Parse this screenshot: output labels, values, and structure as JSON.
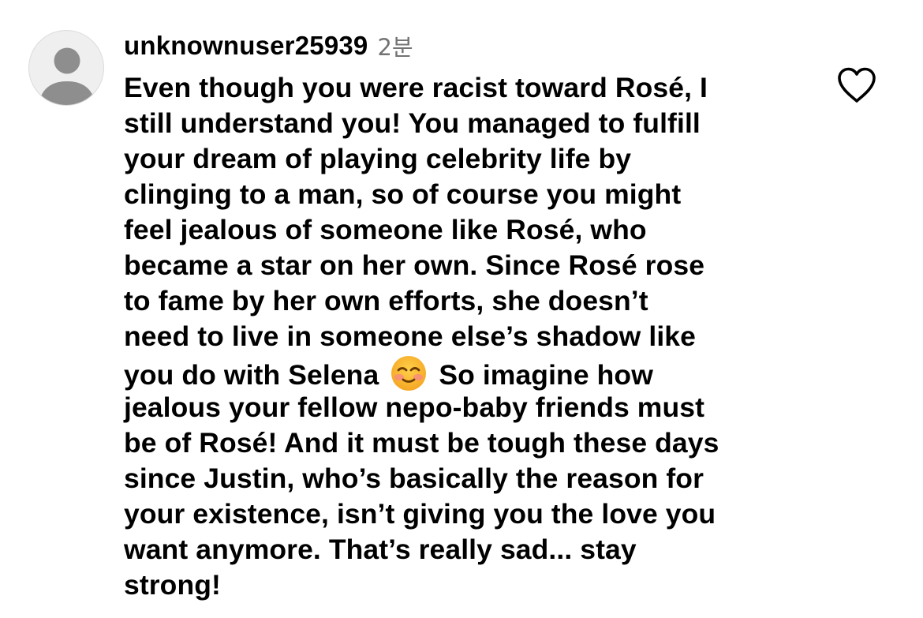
{
  "comment": {
    "username": "unknownuser25939",
    "timestamp": "2분",
    "avatar_icon": "default-person-icon",
    "like_icon": "heart-outline-icon",
    "emoji_icon": "smiling-face-emoji",
    "lines": [
      "Even though you were racist toward Rosé, I",
      "still understand you! You managed to fulfill",
      "your dream of playing celebrity life by",
      "clinging to a man, so of course you might",
      "feel jealous of someone like Rosé, who",
      "became a star on her own. Since Rosé rose",
      "to fame by her own efforts, she doesn’t",
      "need to live in someone else’s shadow like",
      "you do with Selena",
      "So imagine how",
      "jealous your fellow nepo-baby friends must",
      "be of Rosé! And it must be tough these days",
      "since Justin, who’s basically the reason for",
      "your existence, isn’t giving you the love you",
      "want anymore. That’s really sad... stay",
      "strong!"
    ],
    "colors": {
      "text": "#000000",
      "timestamp": "#737373",
      "avatar_bg": "#efefef",
      "avatar_figure": "#8e8e8e",
      "heart": "#000000"
    }
  }
}
